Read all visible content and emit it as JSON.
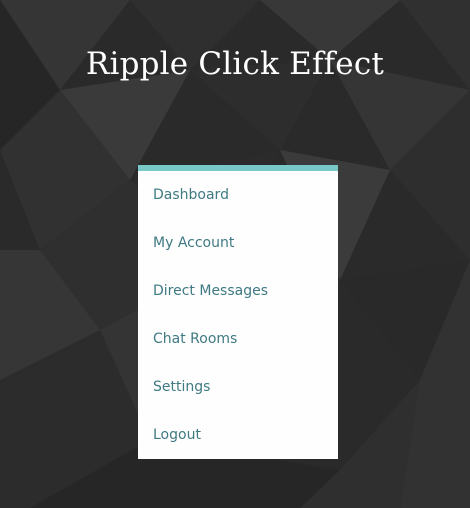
{
  "page": {
    "title": "Ripple Click Effect"
  },
  "menu": {
    "accent_color": "#7ac7c7",
    "items": [
      {
        "label": "Dashboard"
      },
      {
        "label": "My Account"
      },
      {
        "label": "Direct Messages"
      },
      {
        "label": "Chat Rooms"
      },
      {
        "label": "Settings"
      },
      {
        "label": "Logout"
      }
    ]
  }
}
